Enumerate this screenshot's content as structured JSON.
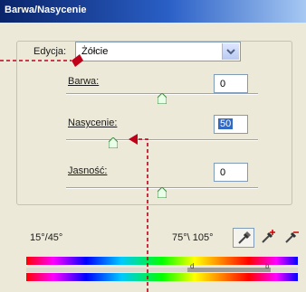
{
  "window": {
    "title": "Barwa/Nasycenie"
  },
  "edit": {
    "label": "Edycja:",
    "value": "Żółcie"
  },
  "sliders": {
    "hue": {
      "label": "Barwa:",
      "value": "0",
      "position": 0.5
    },
    "saturation": {
      "label": "Nasycenie:",
      "value": "50",
      "position": 0.25
    },
    "lightness": {
      "label": "Jasność:",
      "value": "0",
      "position": 0.5
    }
  },
  "range": {
    "left": "15°/45°",
    "right": "75°\\ 105°"
  },
  "range_markers": {
    "left": "d",
    "right": "b"
  },
  "icons": [
    "eyedropper-icon",
    "eyedropper-plus-icon",
    "eyedropper-minus-icon"
  ],
  "colors": {
    "title_start": "#0a246a",
    "title_end": "#a6c8f2",
    "annotation": "#c0001a",
    "highlight": "#316ac5"
  }
}
